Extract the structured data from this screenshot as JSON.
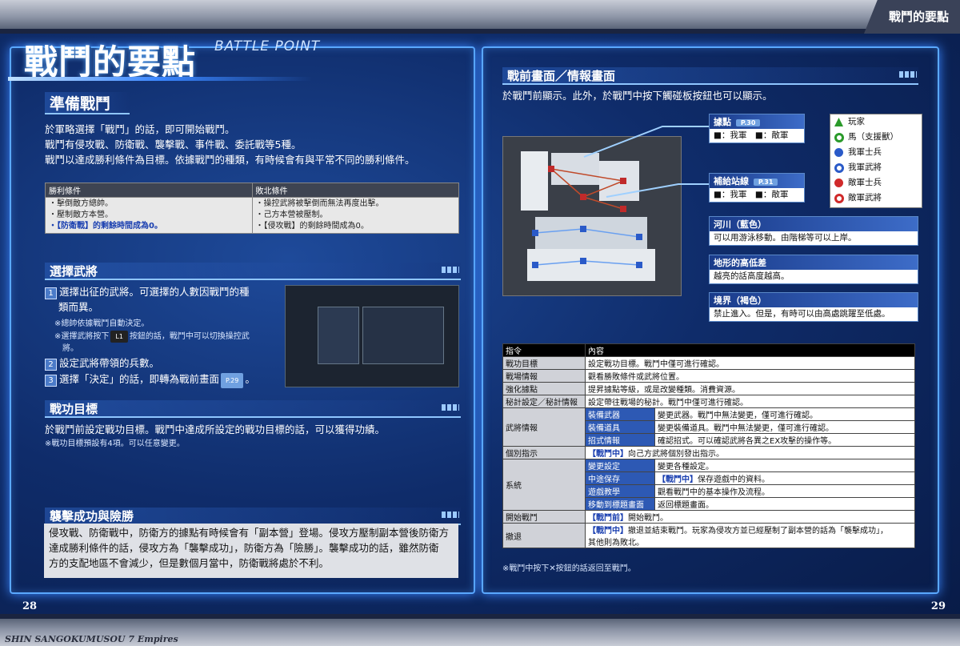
{
  "header": {
    "right_title": "戰鬥的要點",
    "main_title": "戰鬥的要點",
    "main_subtitle": "BATTLE POINT"
  },
  "footer": {
    "game_title": "SHIN SANGOKUMUSOU 7 Empires",
    "page_left": "28",
    "page_right": "29"
  },
  "prep": {
    "heading": "準備戰鬥",
    "line1": "於軍略選擇「戰鬥」的話，即可開始戰鬥。",
    "line2": "戰鬥有侵攻戰、防衛戰、襲擊戰、事件戰、委託戰等5種。",
    "line3": "戰鬥以達成勝利條件為目標。依據戰鬥的種類，有時候會有與平常不同的勝利條件。",
    "win_header": "勝利條件",
    "lose_header": "敗北條件",
    "win": [
      "・擊倒敵方總帥。",
      "・壓制敵方本營。",
      "・【防衛戰】的剩餘時間成為0。"
    ],
    "lose": [
      "・操控武將被擊倒而無法再度出擊。",
      "・己方本營被壓制。",
      "・【侵攻戰】的剩餘時間成為0。"
    ]
  },
  "select": {
    "heading": "選擇武將",
    "step1a": "選擇出征的武將。可選擇的人數因戰鬥的種",
    "step1b": "類而異。",
    "note1": "※總帥依據戰鬥自動決定。",
    "note2a": "※選擇武將按下",
    "note2btn": "L1",
    "note2b": "按鈕的話，戰鬥中可以切換操控武",
    "note2c": "將。",
    "step2": "設定武將帶領的兵數。",
    "step3": "選擇「決定」的話，即轉為戰前畫面",
    "step3ref": "P.29",
    "step3end": "。",
    "n1": "1",
    "n2": "2",
    "n3": "3"
  },
  "merit": {
    "heading": "戰功目標",
    "text": "於戰鬥前設定戰功目標。戰鬥中達成所設定的戰功目標的話，可以獲得功績。",
    "note": "※戰功目標預設有4項。可以任意變更。"
  },
  "raid": {
    "heading": "襲擊成功與險勝",
    "text1": "侵攻戰、防衛戰中，防衛方的據點有時候會有「副本營」登場。侵攻方壓制副本營後防衛方",
    "text2": "達成勝利條件的話，侵攻方為「襲擊成功」，防衛方為「險勝」。襲擊成功的話，雖然防衛",
    "text3": "方的支配地區不會減少，但是數個月當中，防衛戰將處於不利。"
  },
  "prebattle": {
    "heading": "戰前畫面／情報畫面",
    "intro": "於戰鬥前顯示。此外，於戰鬥中按下觸碰板按鈕也可以顯示。",
    "base_title": "據點",
    "base_ref": "P.30",
    "base_body": "■：我軍　■：敵軍",
    "supply_title": "補給站線",
    "supply_ref": "P.31",
    "supply_body": "■：我軍　■：敵軍",
    "river_title": "河川（藍色）",
    "river_body": "可以用游泳移動。由階梯等可以上岸。",
    "height_title": "地形的高低差",
    "height_body": "越亮的話高度越高。",
    "border_title": "境界（褐色）",
    "border_body": "禁止進入。但是，有時可以由高處跳躍至低處。",
    "legend": [
      "玩家",
      "馬（支援獸）",
      "我軍士兵",
      "我軍武將",
      "敵軍士兵",
      "敵軍武將"
    ],
    "legend_colors": [
      "#2a9a2a",
      "#2a9a2a",
      "#2a5ac8",
      "#2a5ac8",
      "#d02a2a",
      "#d02a2a"
    ],
    "footnote": "※戰鬥中按下✕按鈕的話返回至戰鬥。"
  },
  "commands": {
    "col1": "指令",
    "col2": "內容",
    "rows": [
      {
        "k": "戰功目標",
        "v": "設定戰功目標。戰鬥中僅可進行確認。"
      },
      {
        "k": "戰場情報",
        "v": "觀看勝敗條件或武將位置。"
      },
      {
        "k": "強化據點",
        "v": "提昇據點等級，或是改變種類。消費資源。"
      },
      {
        "k": "秘計設定／秘計情報",
        "v": "設定帶往戰場的秘計。戰鬥中僅可進行確認。"
      }
    ],
    "general": {
      "k": "武將情報",
      "subs": [
        {
          "s": "裝備武器",
          "v": "變更武器。戰鬥中無法變更，僅可進行確認。"
        },
        {
          "s": "裝備道具",
          "v": "變更裝備道具。戰鬥中無法變更，僅可進行確認。"
        },
        {
          "s": "招式情報",
          "v": "確認招式。可以確認武將各異之EX攻擊的操作等。"
        }
      ]
    },
    "indiv": {
      "k": "個別指示",
      "tag": "【戰鬥中】",
      "v": "向己方武將個別發出指示。"
    },
    "system": {
      "k": "系統",
      "subs": [
        {
          "s": "變更設定",
          "tag": "",
          "v": "變更各種設定。"
        },
        {
          "s": "中途保存",
          "tag": "【戰鬥中】",
          "v": "保存遊戲中的資料。"
        },
        {
          "s": "遊戲教學",
          "tag": "",
          "v": "觀看戰鬥中的基本操作及流程。"
        },
        {
          "s": "移動到標題畫面",
          "tag": "",
          "v": "返回標題畫面。"
        }
      ]
    },
    "start": {
      "k": "開始戰鬥",
      "tag": "【戰鬥前】",
      "v": "開始戰鬥。"
    },
    "retreat": {
      "k": "撤退",
      "tag": "【戰鬥中】",
      "v": "撤退並結束戰鬥。玩家為侵攻方並已經壓制了副本營的話為「襲擊成功」，",
      "v2": "其他則為敗北。"
    }
  }
}
